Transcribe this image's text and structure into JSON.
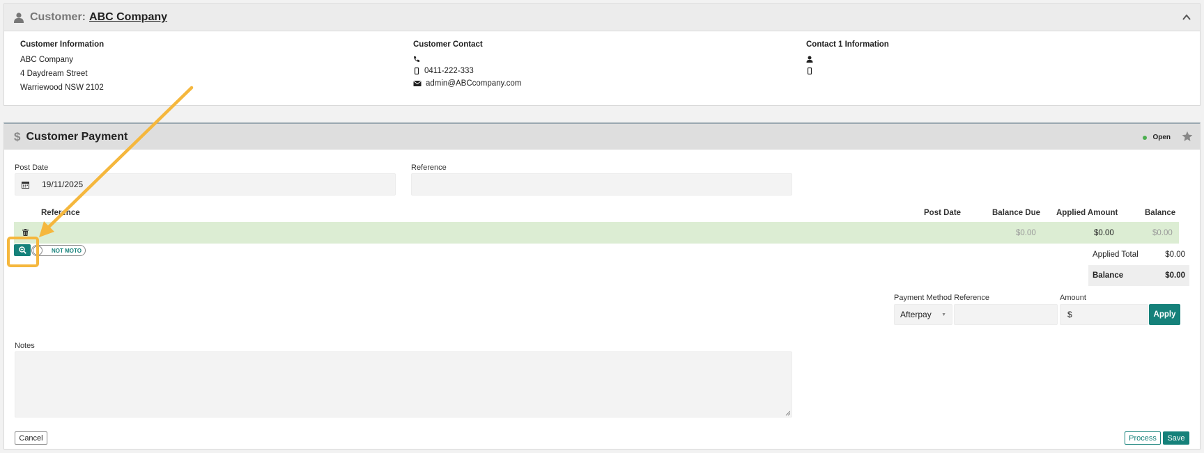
{
  "customer": {
    "title_prefix": "Customer:",
    "name": "ABC Company",
    "info_heading": "Customer Information",
    "address": [
      "ABC Company",
      "4 Daydream Street",
      "Warriewood NSW 2102"
    ],
    "contact_heading": "Customer Contact",
    "phone": "",
    "mobile": "0411-222-333",
    "email": "admin@ABCcompany.com",
    "contact1_heading": "Contact 1 Information"
  },
  "payment": {
    "title": "Customer Payment",
    "status": "Open",
    "post_date_label": "Post Date",
    "post_date_value": "19/11/2025",
    "reference_label": "Reference",
    "reference_value": "",
    "table": {
      "headers": [
        "Reference",
        "Post Date",
        "Balance Due",
        "Applied Amount",
        "Balance"
      ],
      "row": {
        "balance_due": "$0.00",
        "applied_amount": "$0.00",
        "balance": "$0.00"
      }
    },
    "moto_label": "NOT MOTO",
    "totals": {
      "applied_total_label": "Applied Total",
      "applied_total_value": "$0.00",
      "balance_label": "Balance",
      "balance_value": "$0.00"
    },
    "payment_method_label": "Payment Method",
    "payment_method_value": "Afterpay",
    "method_reference_label": "Reference",
    "amount_label": "Amount",
    "amount_value": "$",
    "apply_label": "Apply",
    "notes_label": "Notes",
    "cancel_label": "Cancel",
    "process_label": "Process",
    "save_label": "Save"
  },
  "colors": {
    "accent": "#15817a",
    "highlight": "#f5b73d",
    "row_green": "#dcedd3",
    "status_open": "#4caf50"
  }
}
